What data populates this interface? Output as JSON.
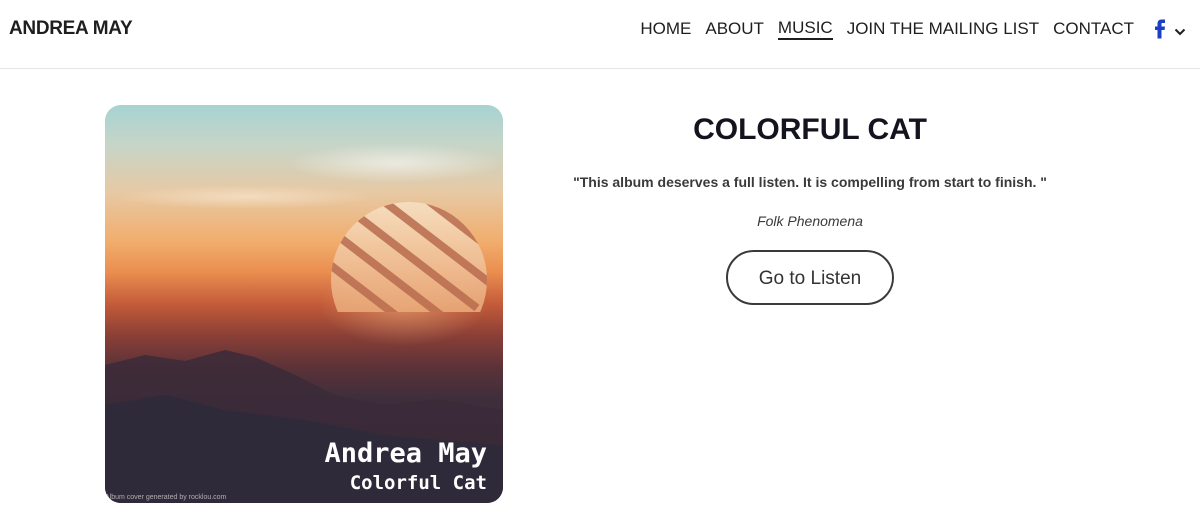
{
  "header": {
    "brand": "ANDREA MAY",
    "nav": [
      {
        "label": "HOME",
        "active": false
      },
      {
        "label": "ABOUT",
        "active": false
      },
      {
        "label": "MUSIC",
        "active": true
      },
      {
        "label": "JOIN THE MAILING LIST",
        "active": false
      },
      {
        "label": "CONTACT",
        "active": false
      }
    ],
    "social_icon": "facebook-icon",
    "more_icon": "chevron-down-icon",
    "accent_color": "#1a3fc4"
  },
  "album": {
    "cover": {
      "artist_text": "Andrea May",
      "album_text": "Colorful Cat",
      "credit_text": "Album cover generated by rocklou.com"
    },
    "title": "COLORFUL CAT",
    "quote": "\"This album deserves a full listen. It is compelling from start to finish. \"",
    "source": "Folk Phenomena",
    "listen_button": "Go to Listen"
  }
}
